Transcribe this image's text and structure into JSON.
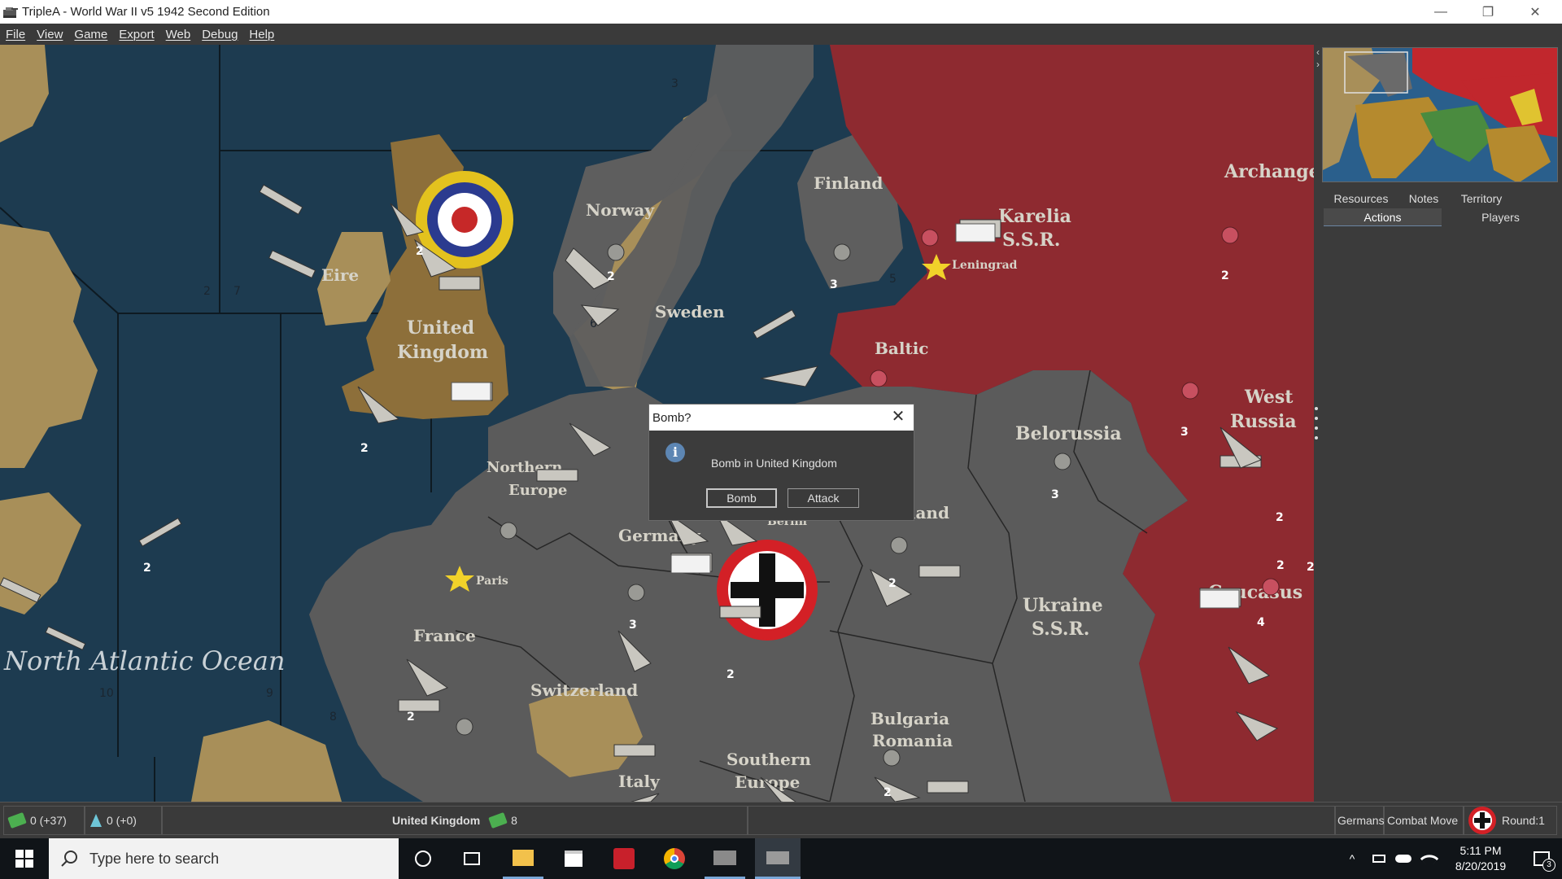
{
  "window": {
    "title": "TripleA - World War II v5 1942 Second Edition",
    "minimize": "—",
    "maximize": "❐",
    "close": "✕"
  },
  "menu": [
    "File",
    "View",
    "Game",
    "Export",
    "Web",
    "Debug",
    "Help"
  ],
  "map": {
    "ocean_label": "North Atlantic Ocean",
    "territories": {
      "finland": "Finland",
      "norway": "Norway",
      "sweden": "Sweden",
      "karelia_1": "Karelia",
      "karelia_2": "S.S.R.",
      "archangel": "Archange",
      "leningrad": "Leningrad",
      "eire": "Eire",
      "uk_1": "United",
      "uk_2": "Kingdom",
      "baltic": "Baltic",
      "belarussia": "Belorussia",
      "west_russia_1": "West",
      "west_russia_2": "Russia",
      "north_europe_1": "Northern",
      "north_europe_2": "Europe",
      "germany": "Germany",
      "berlin": "Berlin",
      "poland": "Poland",
      "paris": "Paris",
      "france": "France",
      "ukraine_1": "Ukraine",
      "ukraine_2": "S.S.R.",
      "caucasus": "Caucasus",
      "switzerland": "Switzerland",
      "bulgaria_1": "Bulgaria",
      "bulgaria_2": "Romania",
      "southern_europe_1": "Southern",
      "southern_europe_2": "Europe",
      "italy": "Italy"
    },
    "unit_counts": [
      "2",
      "2",
      "3",
      "2",
      "2",
      "2",
      "3",
      "2",
      "3",
      "2",
      "2",
      "3",
      "2",
      "2",
      "2",
      "4",
      "2"
    ],
    "sea_zone_numbers": [
      "3",
      "2",
      "7",
      "6",
      "5",
      "10",
      "9",
      "8"
    ]
  },
  "dialog": {
    "title": "Bomb?",
    "message": "Bomb in United Kingdom",
    "bomb_label": "Bomb",
    "attack_label": "Attack",
    "info_glyph": "i",
    "close": "✕"
  },
  "right_panel": {
    "tabs_row1": [
      "Resources",
      "Notes",
      "Territory"
    ],
    "tabs_row2": [
      "Actions",
      "Players"
    ],
    "active_tab": "Actions",
    "collapse_left": "‹",
    "collapse_right": "›"
  },
  "status": {
    "pus": "0 (+37)",
    "tech": "0 (+0)",
    "territory": "United Kingdom",
    "territory_value": "8",
    "player": "Germans",
    "phase": "Combat Move",
    "round": "Round:1"
  },
  "taskbar": {
    "search_placeholder": "Type here to search",
    "time": "5:11 PM",
    "date": "8/20/2019",
    "notifications": "3"
  },
  "colors": {
    "allies_red": "#8e2a30",
    "axis_grey": "#5e5e5e",
    "neutral_tan": "#b49a6a",
    "ocean": "#1b3a4f"
  }
}
